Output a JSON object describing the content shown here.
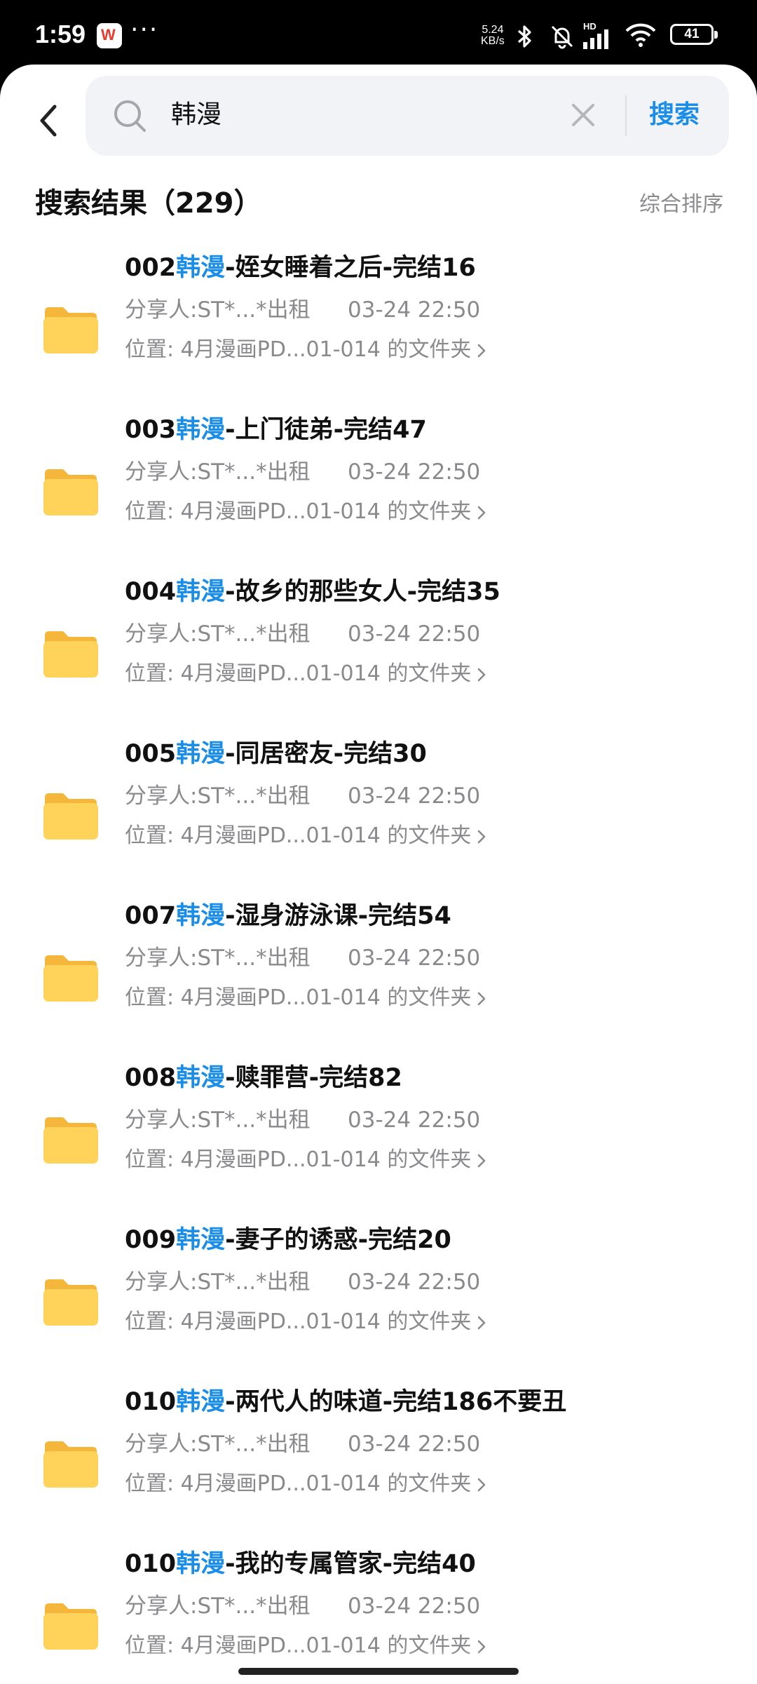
{
  "status_bar": {
    "time": "1:59",
    "app_icon_label": "W",
    "more_dots": "···",
    "net_speed_value": "5.24",
    "net_speed_unit": "KB/s",
    "signal_label": "HD",
    "battery": "41"
  },
  "search": {
    "query": "韩漫",
    "button_label": "搜索"
  },
  "results": {
    "title": "搜索结果（229）",
    "sort_label": "综合排序",
    "highlight_color": "#1a8de9",
    "items": [
      {
        "prefix": "002",
        "keyword": "韩漫",
        "suffix": "-姪女睡着之后-完结16",
        "sharer": "分享人:ST*...*出租",
        "time": "03-24 22:50",
        "location": "位置: 4月漫画PD...01-014 的文件夹"
      },
      {
        "prefix": "003",
        "keyword": "韩漫",
        "suffix": "-上门徒弟-完结47",
        "sharer": "分享人:ST*...*出租",
        "time": "03-24 22:50",
        "location": "位置: 4月漫画PD...01-014 的文件夹"
      },
      {
        "prefix": "004",
        "keyword": "韩漫",
        "suffix": "-故乡的那些女人-完结35",
        "sharer": "分享人:ST*...*出租",
        "time": "03-24 22:50",
        "location": "位置: 4月漫画PD...01-014 的文件夹"
      },
      {
        "prefix": "005",
        "keyword": "韩漫",
        "suffix": "-同居密友-完结30",
        "sharer": "分享人:ST*...*出租",
        "time": "03-24 22:50",
        "location": "位置: 4月漫画PD...01-014 的文件夹"
      },
      {
        "prefix": "007",
        "keyword": "韩漫",
        "suffix": "-湿身游泳课-完结54",
        "sharer": "分享人:ST*...*出租",
        "time": "03-24 22:50",
        "location": "位置: 4月漫画PD...01-014 的文件夹"
      },
      {
        "prefix": "008",
        "keyword": "韩漫",
        "suffix": "-赎罪营-完结82",
        "sharer": "分享人:ST*...*出租",
        "time": "03-24 22:50",
        "location": "位置: 4月漫画PD...01-014 的文件夹"
      },
      {
        "prefix": "009",
        "keyword": "韩漫",
        "suffix": "-妻子的诱惑-完结20",
        "sharer": "分享人:ST*...*出租",
        "time": "03-24 22:50",
        "location": "位置: 4月漫画PD...01-014 的文件夹"
      },
      {
        "prefix": "010",
        "keyword": "韩漫",
        "suffix": "-两代人的味道-完结186不要丑",
        "sharer": "分享人:ST*...*出租",
        "time": "03-24 22:50",
        "location": "位置: 4月漫画PD...01-014 的文件夹"
      },
      {
        "prefix": "010",
        "keyword": "韩漫",
        "suffix": "-我的专属管家-完结40",
        "sharer": "分享人:ST*...*出租",
        "time": "03-24 22:50",
        "location": "位置: 4月漫画PD...01-014 的文件夹"
      }
    ]
  }
}
